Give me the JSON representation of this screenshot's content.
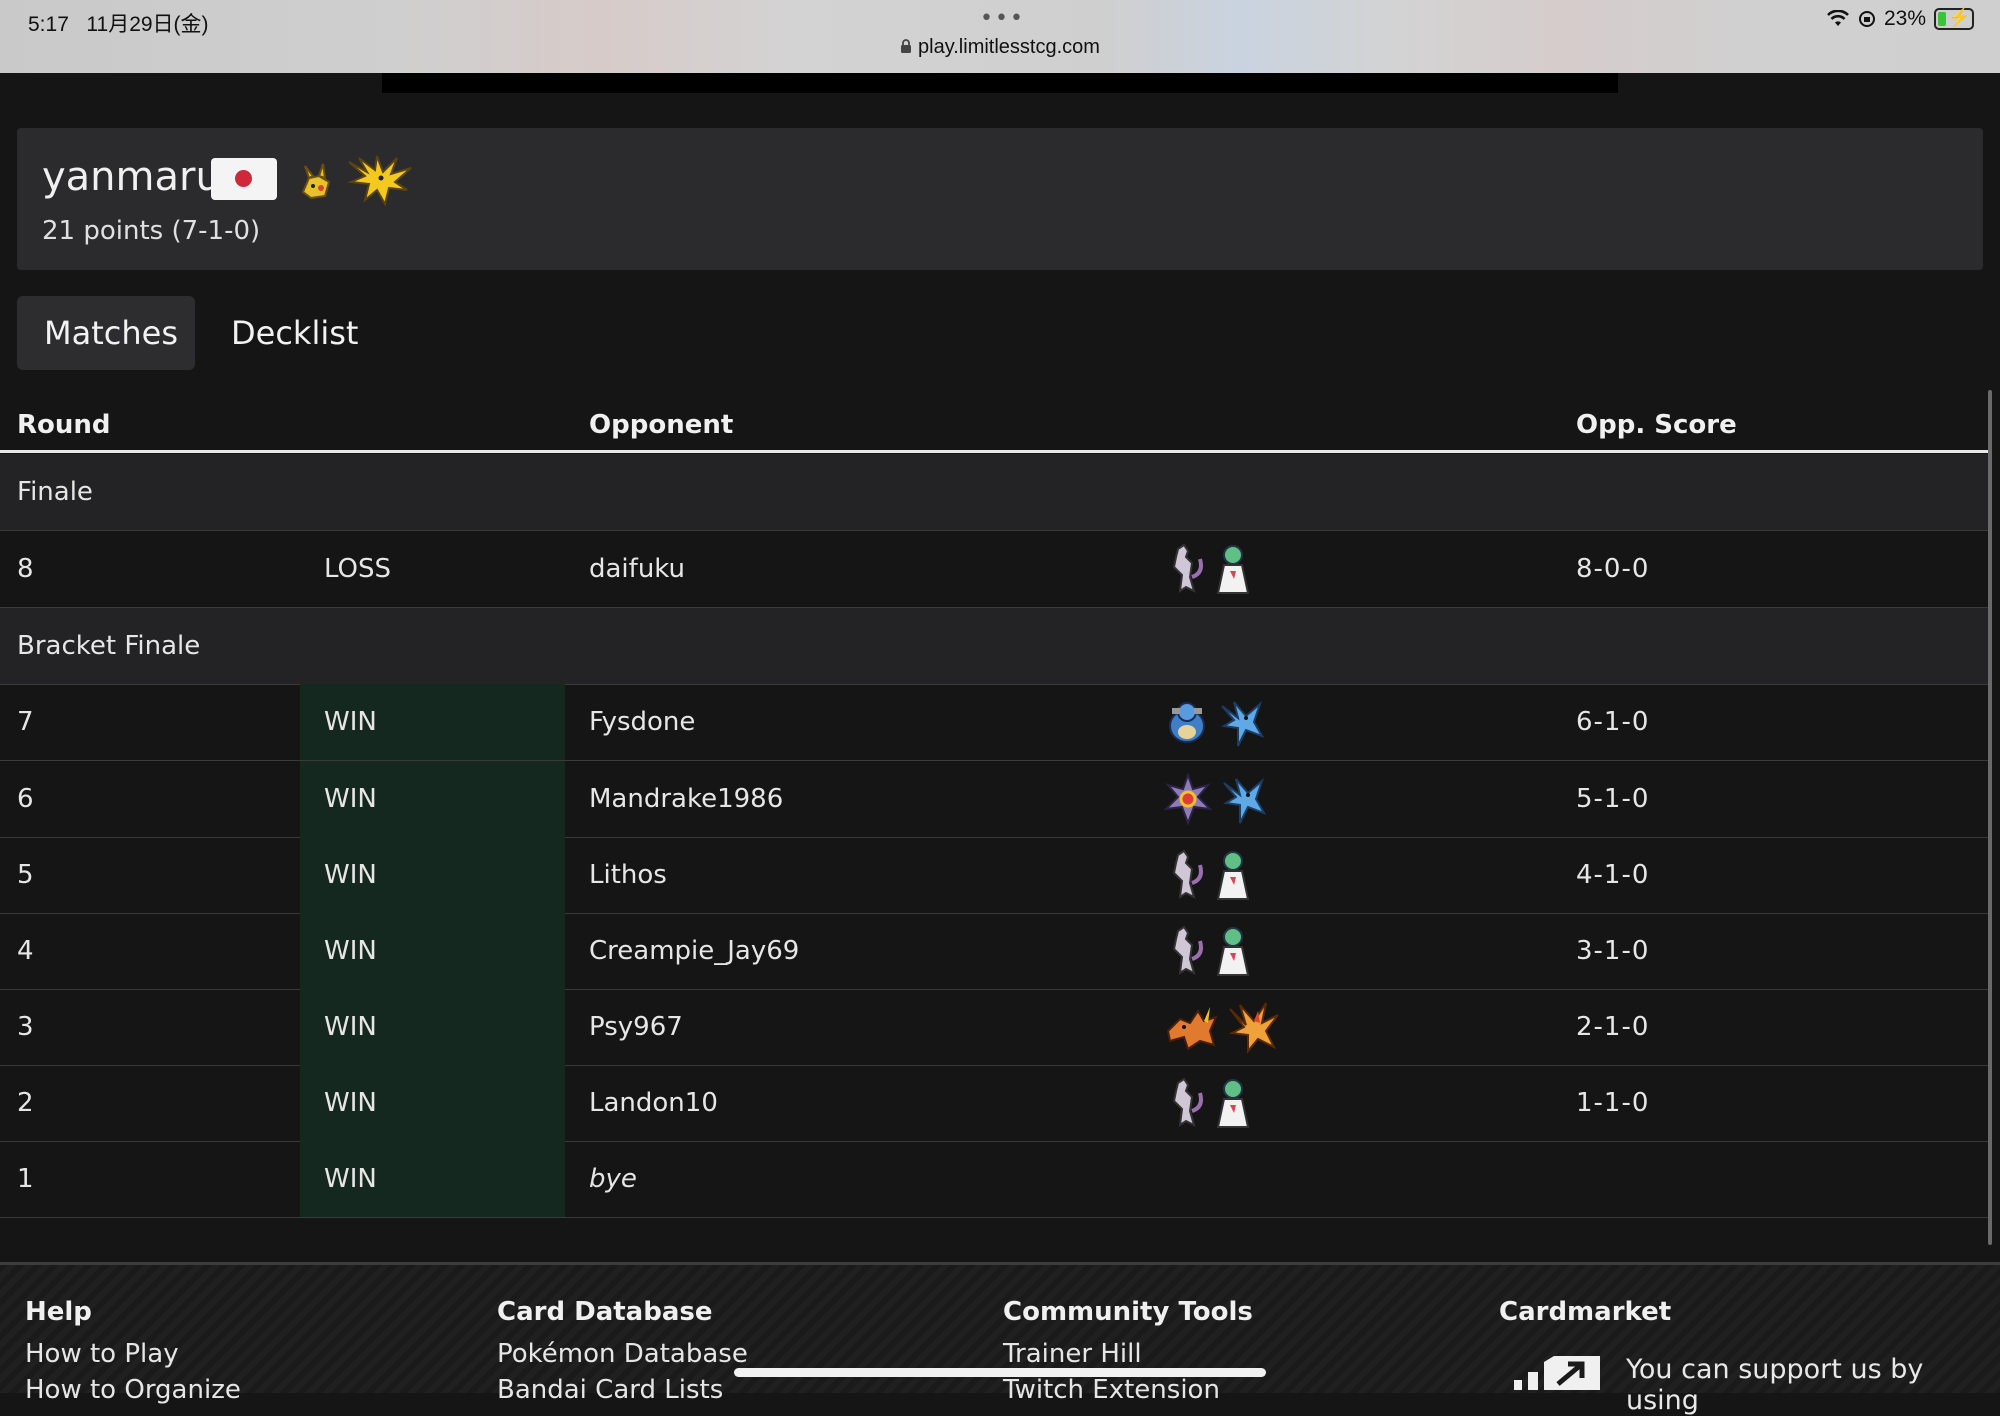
{
  "status_bar": {
    "time": "5:17",
    "date": "11月29日(金)",
    "dots": "•••",
    "url": "play.limitlesstcg.com",
    "battery": "23%"
  },
  "player": {
    "name": "yanmaru",
    "country_flag": "japan-flag",
    "deck_icons": [
      "pikachu-icon",
      "zapdos-icon"
    ],
    "points": "21 points (7-1-0)"
  },
  "tabs": [
    {
      "label": "Matches",
      "active": true
    },
    {
      "label": "Decklist",
      "active": false
    }
  ],
  "table": {
    "headers": {
      "round": "Round",
      "opponent": "Opponent",
      "opp_score": "Opp. Score"
    },
    "sections": [
      {
        "title": "Finale"
      },
      {
        "title": "Bracket Finale"
      }
    ],
    "rows": [
      {
        "round": "8",
        "result": "LOSS",
        "opponent": "daifuku",
        "deck": [
          "mewtwo-icon",
          "gardevoir-icon"
        ],
        "score": "8-0-0"
      },
      {
        "round": "7",
        "result": "WIN",
        "opponent": "Fysdone",
        "deck": [
          "blastoise-icon",
          "articuno-icon"
        ],
        "score": "6-1-0"
      },
      {
        "round": "6",
        "result": "WIN",
        "opponent": "Mandrake1986",
        "deck": [
          "starmie-icon",
          "articuno-icon"
        ],
        "score": "5-1-0"
      },
      {
        "round": "5",
        "result": "WIN",
        "opponent": "Lithos",
        "deck": [
          "mewtwo-icon",
          "gardevoir-icon"
        ],
        "score": "4-1-0"
      },
      {
        "round": "4",
        "result": "WIN",
        "opponent": "Creampie_Jay69",
        "deck": [
          "mewtwo-icon",
          "gardevoir-icon"
        ],
        "score": "3-1-0"
      },
      {
        "round": "3",
        "result": "WIN",
        "opponent": "Psy967",
        "deck": [
          "charizard-icon",
          "moltres-icon"
        ],
        "score": "2-1-0"
      },
      {
        "round": "2",
        "result": "WIN",
        "opponent": "Landon10",
        "deck": [
          "mewtwo-icon",
          "gardevoir-icon"
        ],
        "score": "1-1-0"
      },
      {
        "round": "1",
        "result": "WIN",
        "opponent": "bye",
        "deck": [],
        "score": ""
      }
    ]
  },
  "footer": {
    "help": {
      "title": "Help",
      "links": [
        "How to Play",
        "How to Organize"
      ]
    },
    "card_database": {
      "title": "Card Database",
      "links": [
        "Pokémon Database",
        "Bandai Card Lists"
      ]
    },
    "community_tools": {
      "title": "Community Tools",
      "links": [
        "Trainer Hill",
        "Twitch Extension"
      ]
    },
    "cardmarket": {
      "title": "Cardmarket",
      "text": "You can support us by using"
    }
  },
  "colors": {
    "background": "#151515",
    "card": "#2b2b2d",
    "win_cell": "#15281f",
    "section_row": "#232325"
  }
}
